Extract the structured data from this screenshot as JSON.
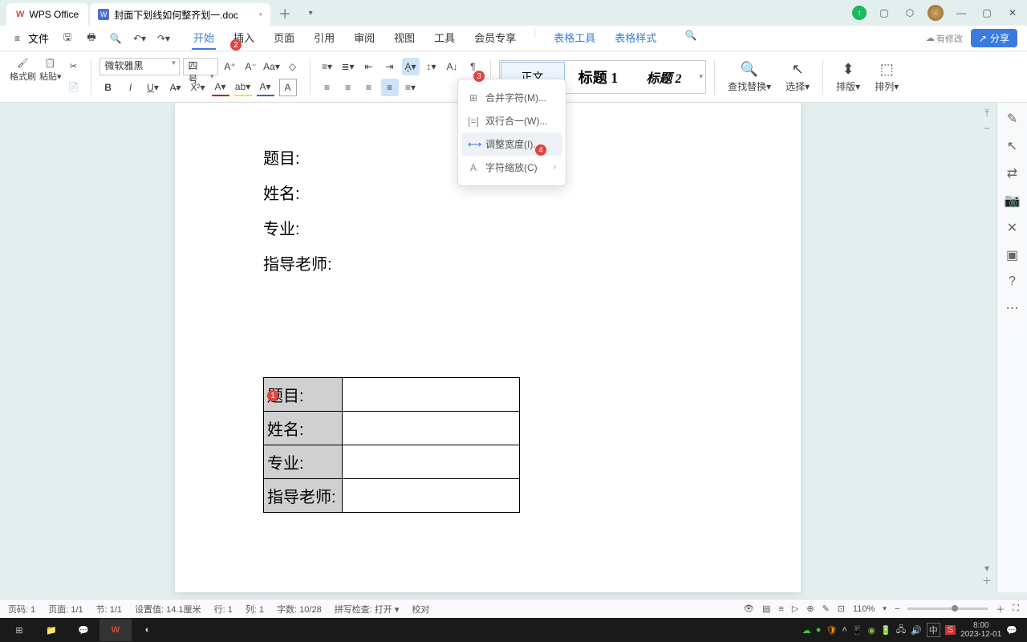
{
  "titlebar": {
    "app_name": "WPS Office",
    "doc_name": "封面下划线如何整齐划一.doc",
    "doc_letter": "W"
  },
  "menubar": {
    "file": "文件",
    "tabs": [
      "开始",
      "插入",
      "页面",
      "引用",
      "审阅",
      "视图",
      "工具",
      "会员专享"
    ],
    "ctx_tabs": [
      "表格工具",
      "表格样式"
    ],
    "modify": "有修改",
    "share": "分享"
  },
  "ribbon": {
    "format_painter": "格式刷",
    "paste": "粘贴",
    "font_name": "微软雅黑",
    "font_size": "四号",
    "style_normal": "正文",
    "style_h1": "标题 1",
    "style_h2": "标题 2",
    "find_replace": "查找替换",
    "select": "选择",
    "arrange": "排版",
    "array": "排列"
  },
  "dropdown": {
    "merge": "合并字符(M)...",
    "twoline": "双行合一(W)...",
    "fitwidth": "调整宽度(I)...",
    "charscale": "字符缩放(C)"
  },
  "document": {
    "lines": [
      "题目:",
      "姓名:",
      "专业:",
      "指导老师:"
    ],
    "table_labels": [
      "题目:",
      "姓名:",
      "专业:",
      "指导老师:"
    ]
  },
  "statusbar": {
    "page_no": "页码: 1",
    "page": "页面: 1/1",
    "section": "节: 1/1",
    "setpos": "设置值: 14.1厘米",
    "row": "行: 1",
    "col": "列: 1",
    "words": "字数: 10/28",
    "spell": "拼写检查: 打开",
    "proof": "校对",
    "zoom": "110%"
  },
  "taskbar": {
    "time": "8:00",
    "date": "2023-12-01",
    "ime1": "中",
    "ime2": "S"
  },
  "badges": {
    "b1": "1",
    "b2": "2",
    "b3": "3",
    "b4": "4"
  }
}
